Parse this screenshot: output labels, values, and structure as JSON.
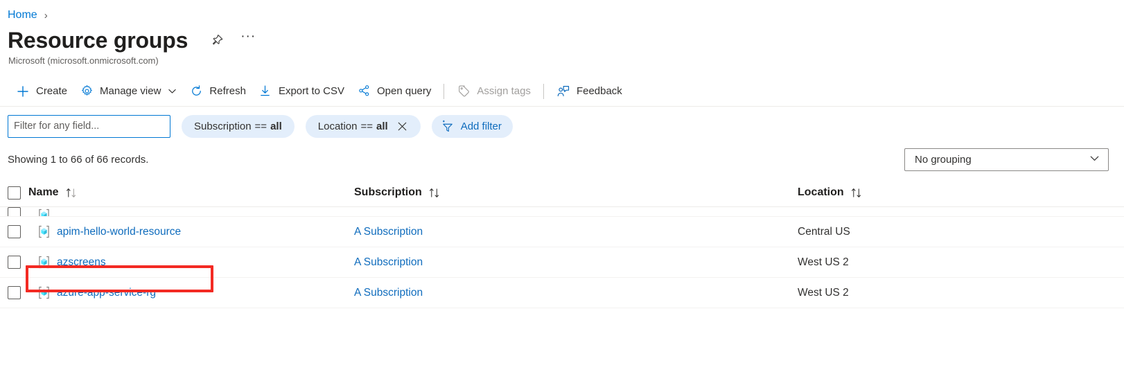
{
  "breadcrumb": {
    "home_label": "Home",
    "separator": "›"
  },
  "header": {
    "title": "Resource groups",
    "subtitle": "Microsoft (microsoft.onmicrosoft.com)",
    "pin_icon": "pin-icon",
    "more_icon": "ellipsis-icon",
    "more_label": "···"
  },
  "toolbar": {
    "items": [
      {
        "id": "create",
        "label": "Create",
        "icon": "plus-icon",
        "disabled": false,
        "chevron": false
      },
      {
        "id": "manage-view",
        "label": "Manage view",
        "icon": "gear-icon",
        "disabled": false,
        "chevron": true
      },
      {
        "id": "refresh",
        "label": "Refresh",
        "icon": "refresh-icon",
        "disabled": false,
        "chevron": false
      },
      {
        "id": "export-to-csv",
        "label": "Export to CSV",
        "icon": "download-icon",
        "disabled": false,
        "chevron": false
      },
      {
        "id": "open-query",
        "label": "Open query",
        "icon": "share-node-icon",
        "disabled": false,
        "chevron": false
      },
      {
        "id": "assign-tags",
        "label": "Assign tags",
        "icon": "tag-icon",
        "disabled": true,
        "chevron": false
      },
      {
        "id": "feedback",
        "label": "Feedback",
        "icon": "feedback-icon",
        "disabled": false,
        "chevron": false
      }
    ]
  },
  "filters": {
    "search_placeholder": "Filter for any field...",
    "search_value": "",
    "chips": [
      {
        "id": "subscription",
        "field": "Subscription",
        "operator": "==",
        "value": "all",
        "removable": false
      },
      {
        "id": "location",
        "field": "Location",
        "operator": "==",
        "value": "all",
        "removable": true
      }
    ],
    "add_filter_label": "Add filter"
  },
  "summary": {
    "records_text": "Showing 1 to 66 of 66 records.",
    "grouping_value": "No grouping"
  },
  "table": {
    "columns": [
      {
        "id": "name",
        "label": "Name",
        "sortable": true
      },
      {
        "id": "subscription",
        "label": "Subscription",
        "sortable": true
      },
      {
        "id": "location",
        "label": "Location",
        "sortable": true
      }
    ],
    "rows": [
      {
        "name": "",
        "subscription": "",
        "location": "",
        "partial": true,
        "highlighted": false
      },
      {
        "name": "apim-hello-world-resource",
        "subscription": "A Subscription",
        "location": "Central US",
        "partial": false,
        "highlighted": true
      },
      {
        "name": "azscreens",
        "subscription": "A Subscription",
        "location": "West US 2",
        "partial": false,
        "highlighted": false
      },
      {
        "name": "azure-app-service-rg",
        "subscription": "A Subscription",
        "location": "West US 2",
        "partial": false,
        "highlighted": false
      }
    ]
  },
  "colors": {
    "accent": "#0078d4",
    "link": "#0f6cbd",
    "annotation": "#f32a23",
    "chip_bg": "#e3eefb",
    "disabled": "#a19f9d"
  }
}
